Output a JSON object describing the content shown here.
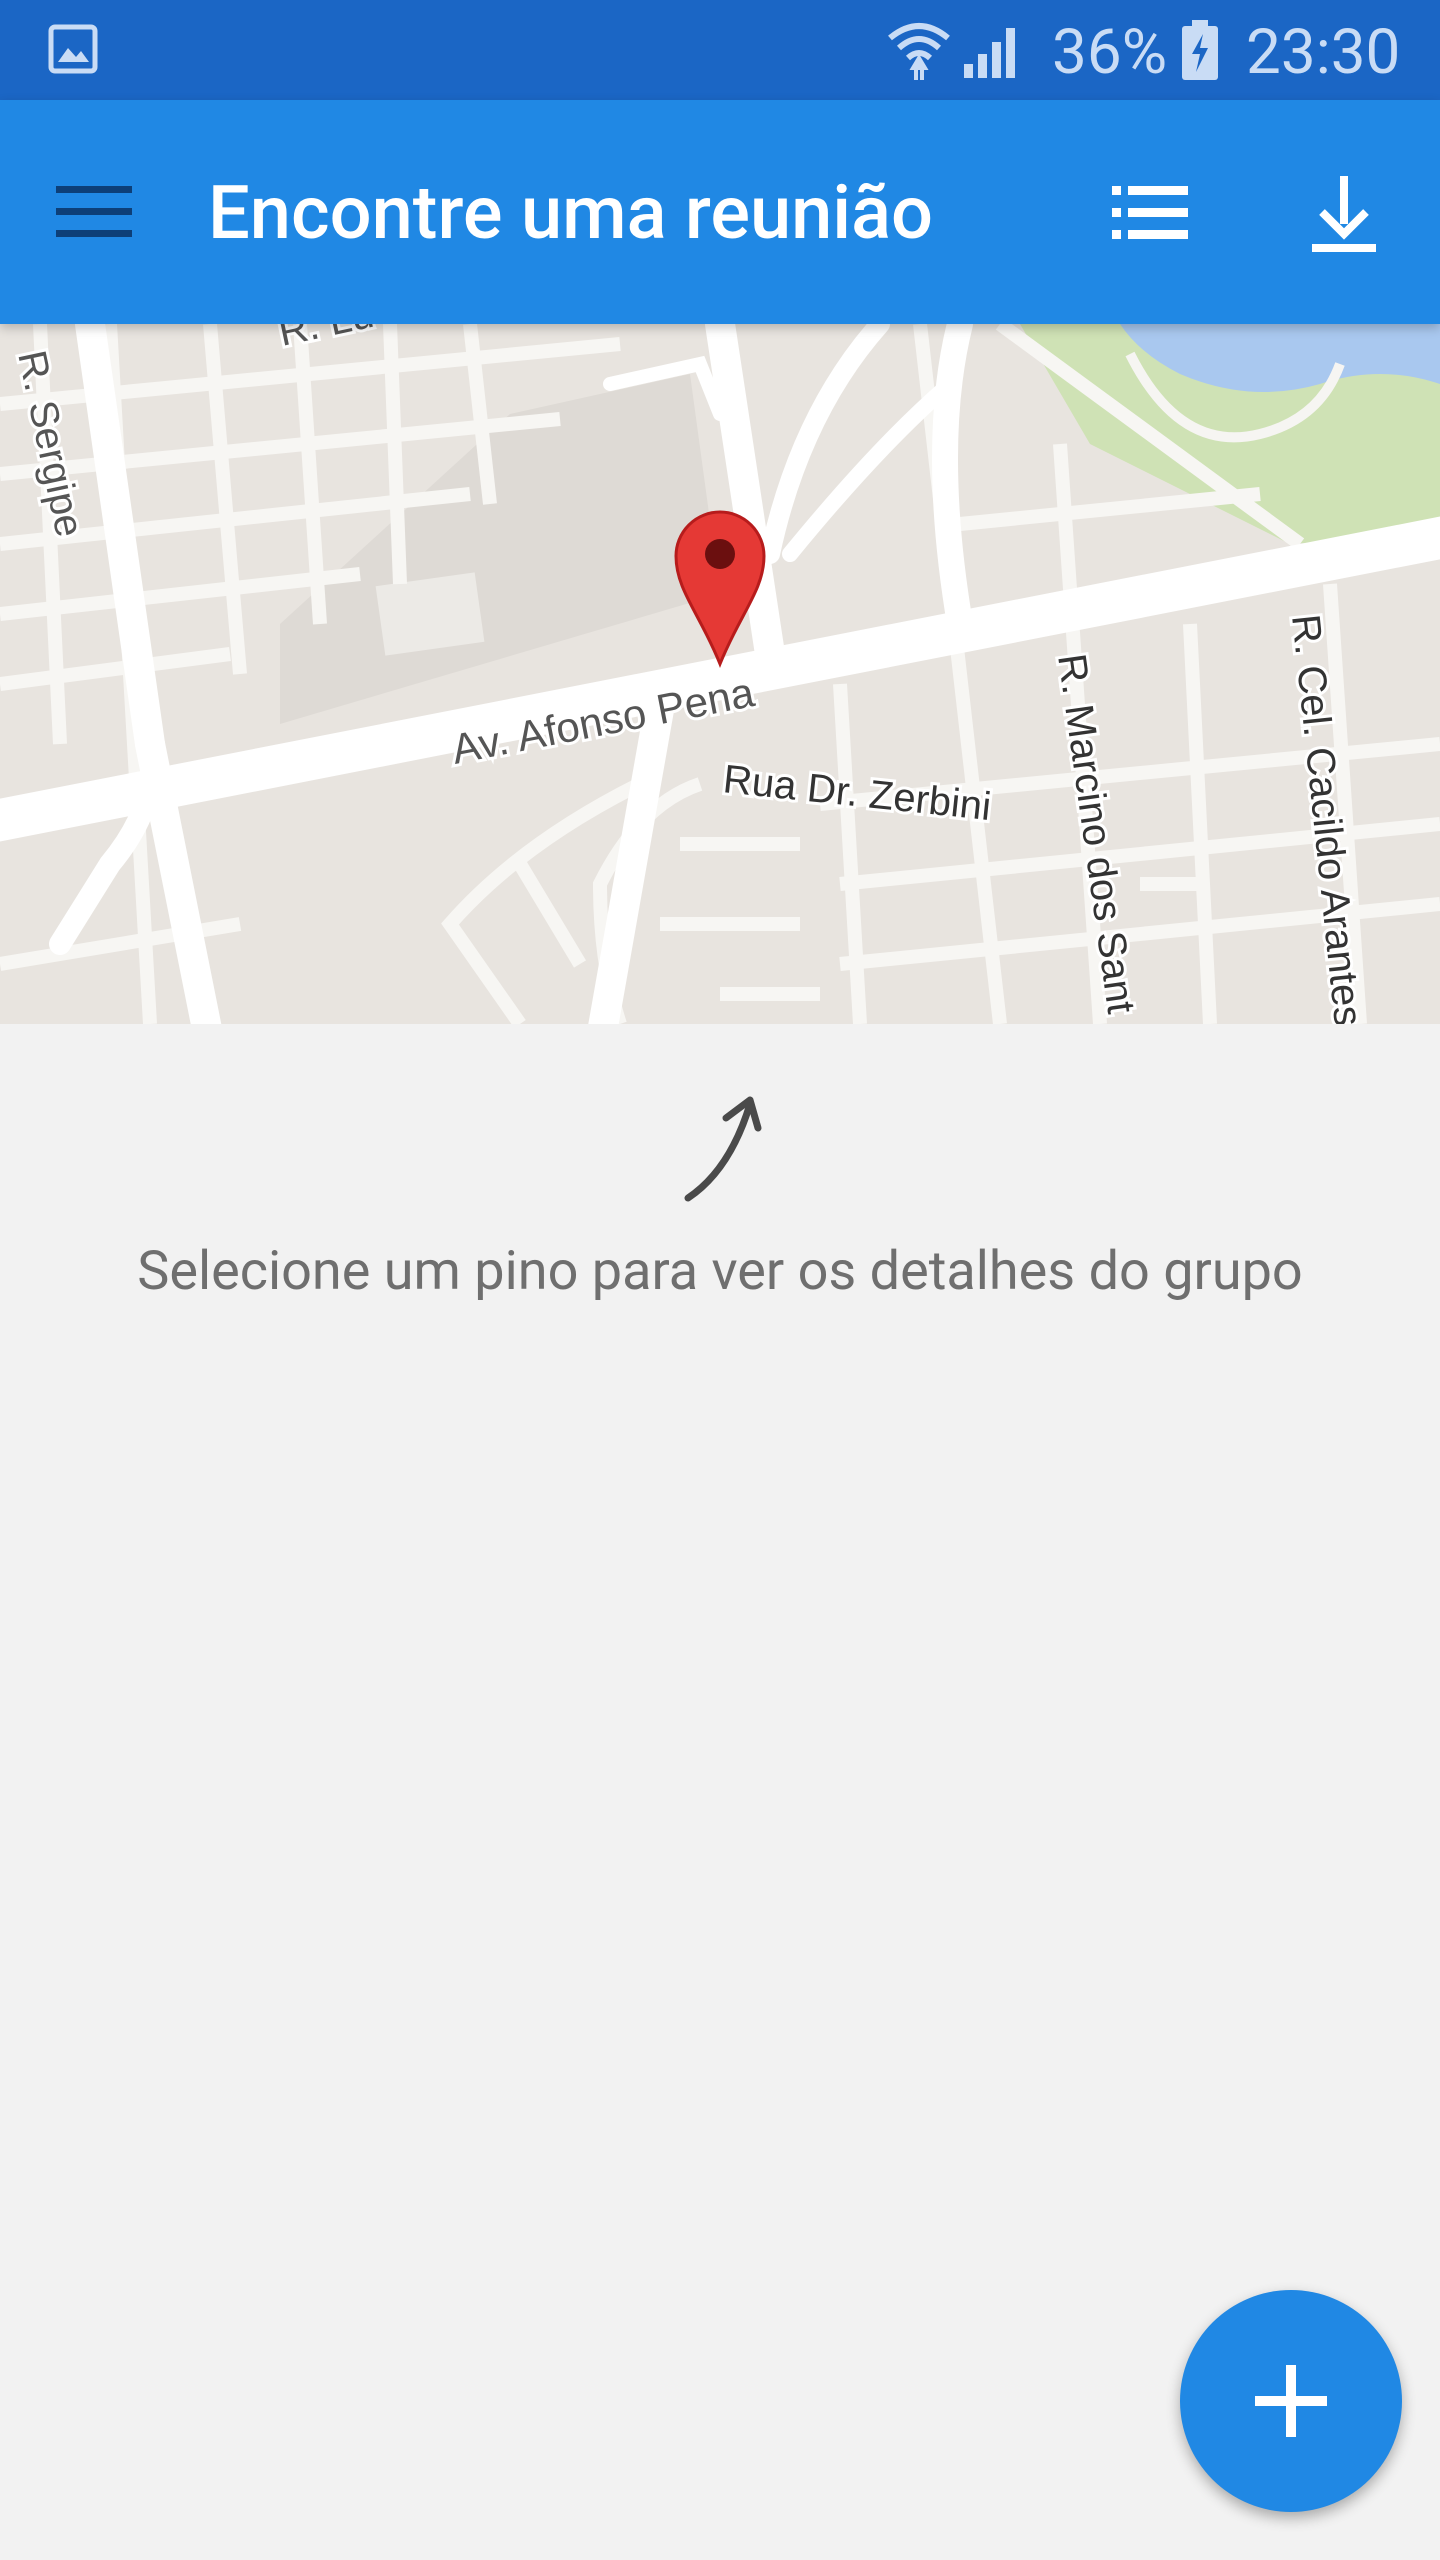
{
  "status_bar": {
    "battery_percent": "36%",
    "time": "23:30",
    "icons": [
      "gallery-icon",
      "wifi-icon",
      "signal-icon",
      "battery-charging-icon"
    ]
  },
  "app_bar": {
    "title": "Encontre uma reunião",
    "icons": [
      "menu-icon",
      "list-icon",
      "download-icon"
    ]
  },
  "map": {
    "street_labels": [
      "R. Sergipe",
      "R. Lu",
      "Av. Afonso Pena",
      "Rua Dr. Zerbini",
      "R. Marcino dos Sant",
      "R. Cel. Cacildo Arantes"
    ],
    "marker": "map-pin-icon"
  },
  "hint": {
    "text": "Selecione um pino para ver os detalhes do grupo",
    "icon": "curved-arrow-icon"
  },
  "fab": {
    "icon": "plus-icon"
  },
  "colors": {
    "status_bar": "#1b66c5",
    "app_bar": "#2088e4",
    "background": "#f2f2f2",
    "pin": "#e53935"
  }
}
